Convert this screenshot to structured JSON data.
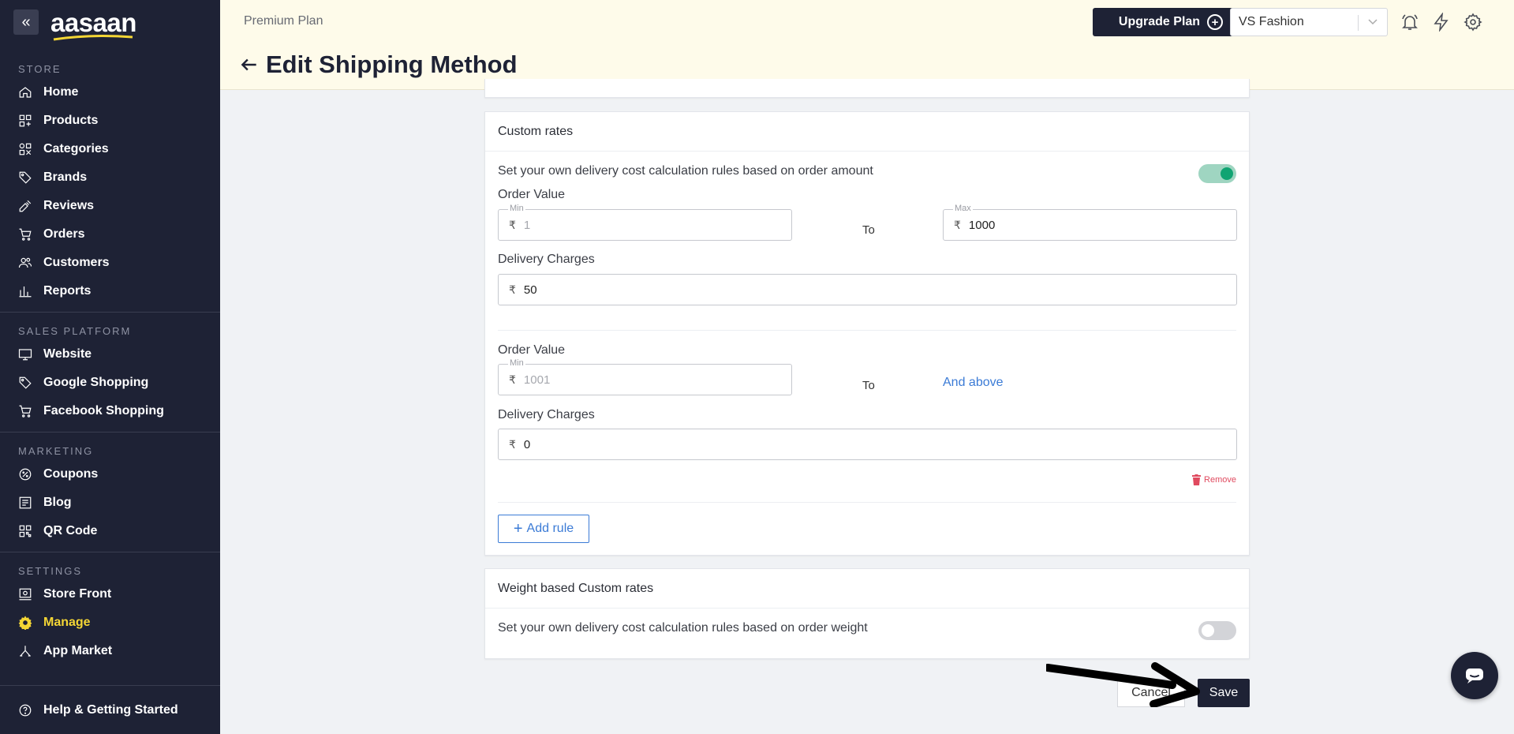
{
  "sidebar": {
    "logo": "aasaan",
    "sections": {
      "store": "STORE",
      "sales": "SALES PLATFORM",
      "marketing": "MARKETING",
      "settings": "SETTINGS"
    },
    "store_items": [
      "Home",
      "Products",
      "Categories",
      "Brands",
      "Reviews",
      "Orders",
      "Customers",
      "Reports"
    ],
    "sales_items": [
      "Website",
      "Google Shopping",
      "Facebook Shopping"
    ],
    "marketing_items": [
      "Coupons",
      "Blog",
      "QR Code"
    ],
    "settings_items": [
      "Store Front",
      "Manage",
      "App Market"
    ],
    "active_item": "Manage",
    "help": "Help & Getting Started"
  },
  "header": {
    "plan": "Premium Plan",
    "upgrade_label": "Upgrade Plan",
    "store_name": "VS Fashion",
    "title": "Edit Shipping Method"
  },
  "custom_rates": {
    "title": "Custom rates",
    "description": "Set your own delivery cost calculation rules based on order amount",
    "enabled": true,
    "currency": "₹",
    "to_label": "To",
    "rules": [
      {
        "order_value_label": "Order Value",
        "min_legend": "Min",
        "min_value": "1",
        "max_legend": "Max",
        "max_value": "1000",
        "delivery_label": "Delivery Charges",
        "delivery_value": "50"
      },
      {
        "order_value_label": "Order Value",
        "min_legend": "Min",
        "min_value": "1001",
        "max_text": "And above",
        "delivery_label": "Delivery Charges",
        "delivery_value": "0",
        "remove_label": "Remove"
      }
    ],
    "add_rule_label": "Add rule"
  },
  "weight_rates": {
    "title": "Weight based Custom rates",
    "description": "Set your own delivery cost calculation rules based on order weight",
    "enabled": false
  },
  "actions": {
    "cancel": "Cancel",
    "save": "Save"
  },
  "colors": {
    "sidebar_bg": "#1e2235",
    "header_bg": "#fefbea",
    "active": "#f4d635",
    "toggle_on": "#10a472",
    "link": "#3b7bd6",
    "danger": "#e04a5f"
  }
}
